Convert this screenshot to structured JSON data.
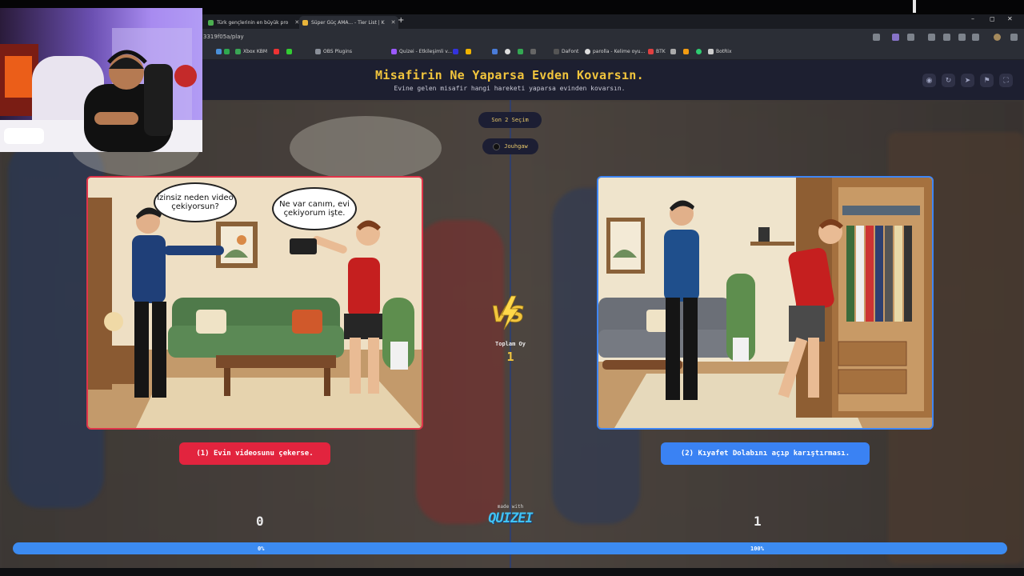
{
  "browser": {
    "tabs": [
      {
        "title": "Türk gençlerinin en büyük pro",
        "active": false
      },
      {
        "title": "Süper Güç AMA... - Tier List | K",
        "active": true
      }
    ],
    "new_tab_symbol": "+",
    "window_controls": [
      "–",
      "◻",
      "✕"
    ],
    "url": "3319f05a/play",
    "bookmarks": [
      {
        "label": "Xbox KBM",
        "color": "#3aa655"
      },
      {
        "label": "OBS Plugins",
        "color": "#8a8f99"
      },
      {
        "label": "Quizei - Etkileşimli v...",
        "color": "#9b59ff"
      },
      {
        "label": "DaFont",
        "color": "#555555"
      },
      {
        "label": "parolla - Kelime oyu...",
        "color": "#dddddd"
      },
      {
        "label": "BTK",
        "color": "#e04040"
      },
      {
        "label": "BotRix",
        "color": "#cccccc"
      }
    ]
  },
  "header": {
    "title": "Misafirin Ne Yaparsa Evden Kovarsın.",
    "subtitle": "Evine gelen misafir hangi hareketi yaparsa evinden kovarsın.",
    "actions": [
      {
        "icon": "eye-icon",
        "glyph": "◉"
      },
      {
        "icon": "share-icon",
        "glyph": "↻"
      },
      {
        "icon": "send-icon",
        "glyph": "➤"
      },
      {
        "icon": "flag-icon",
        "glyph": "⚑"
      },
      {
        "icon": "fullscreen-icon",
        "glyph": "⛶"
      }
    ]
  },
  "round": {
    "label": "Son 2 Seçim",
    "voter": "Jouhgaw"
  },
  "left_option": {
    "speech1": "İzinsiz neden video çekiyorsun?",
    "speech2": "Ne var canım, evi çekiyorum işte.",
    "label": "(1) Evin videosunu çekerse.",
    "count": "0",
    "percent_label": "0%",
    "color": "#e2243e"
  },
  "right_option": {
    "label": "(2) Kıyafet Dolabını açıp karıştırması.",
    "count": "1",
    "percent_label": "100%",
    "color": "#3a82f3"
  },
  "center": {
    "total_label": "Toplam Oy",
    "total_value": "1",
    "made_with": "made with",
    "brand": "QUIZEI"
  },
  "progress": {
    "left_fraction": 0.0,
    "right_fraction": 1.0
  }
}
